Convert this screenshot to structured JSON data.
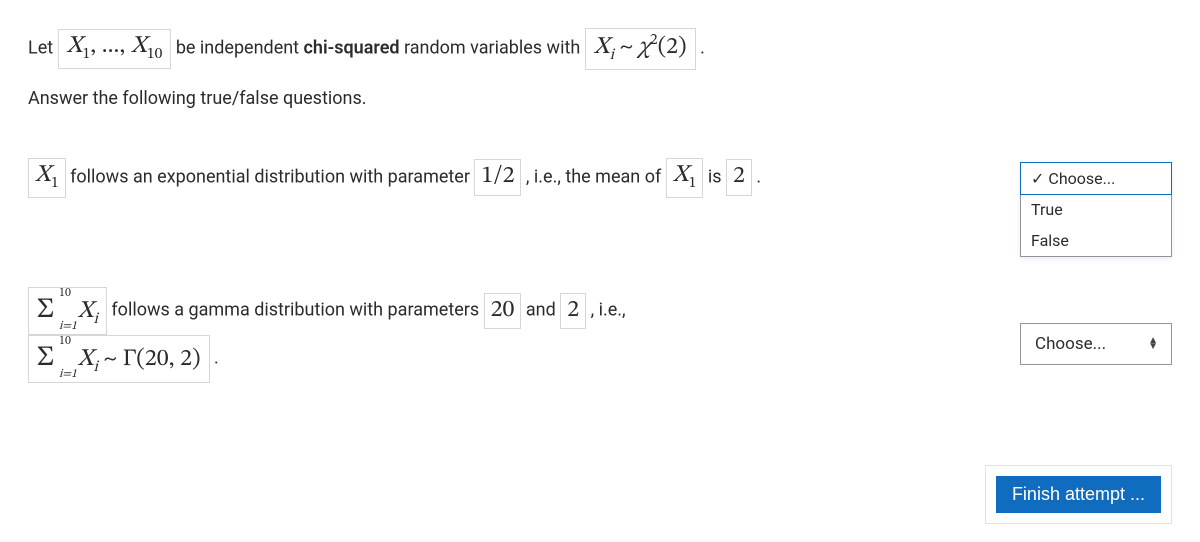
{
  "intro": {
    "let": "Let ",
    "vars": "X₁, ..., X₁₀",
    "be_independent": " be independent ",
    "chi_squared": "chi-squared",
    "random_vars_with": " random variables with ",
    "dist": "Xᵢ ~ χ²(2)",
    "period": " .",
    "answer_following": "Answer the following true/false questions."
  },
  "q1": {
    "x1": "X₁",
    "follows_exp": " follows an exponential distribution with parameter ",
    "half": "1/2",
    "ie_mean_of": " , i.e., the mean of ",
    "x1b": "X₁",
    "is": " is ",
    "two": "2",
    "period": " ."
  },
  "q2": {
    "sum_expr": "Σ",
    "sum_top": "10",
    "sum_bot": "i=1",
    "xi": " Xᵢ",
    "follows_gamma": " follows a gamma distribution with parameters ",
    "twenty": "20",
    "and": " and ",
    "two": "2",
    "ie": " , i.e.,",
    "gamma_expr_xi": " Xᵢ ~ Γ(20, 2)",
    "period": " ."
  },
  "dropdown": {
    "choose": "Choose...",
    "true": "True",
    "false": "False"
  },
  "finish": "Finish attempt ...",
  "icons": {
    "check": "✓"
  }
}
